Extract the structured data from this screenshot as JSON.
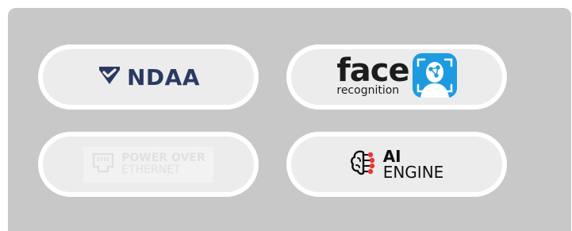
{
  "badges": {
    "ndaa": {
      "label": "NDAA",
      "icon": "shield-check-icon",
      "color": "#2b3a63"
    },
    "face": {
      "title": "face",
      "subtitle": "recognition",
      "icon": "face-scan-icon",
      "accent": "#1e9be0"
    },
    "poe": {
      "line1": "POWER OVER",
      "line2": "ETHERNET",
      "icon": "ethernet-port-icon"
    },
    "ai": {
      "line1": "AI",
      "line2": "ENGINE",
      "icon": "brain-circuit-icon",
      "accent": "#e53935"
    }
  }
}
